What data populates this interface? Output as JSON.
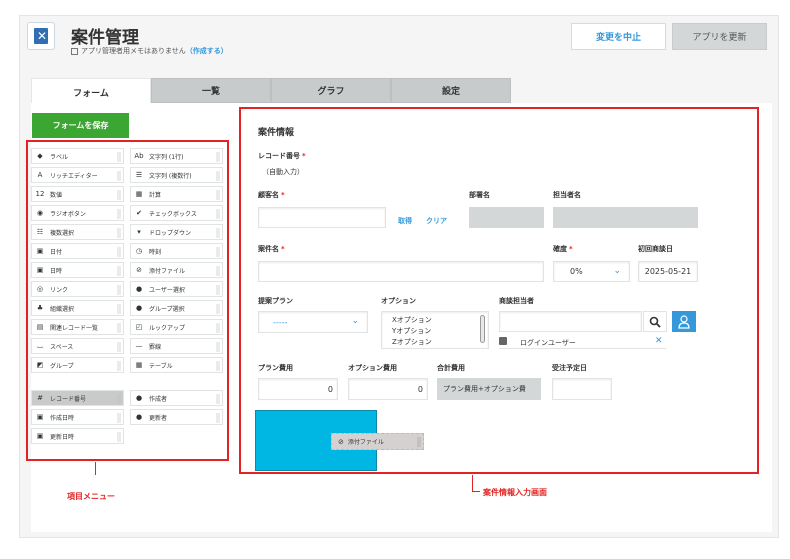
{
  "header": {
    "app_title": "案件管理",
    "memo_text": "アプリ管理者用メモはありません",
    "memo_link": "（作成する）",
    "cancel_label": "変更を中止",
    "update_label": "アプリを更新"
  },
  "tabs": [
    {
      "label": "フォーム"
    },
    {
      "label": "一覧"
    },
    {
      "label": "グラフ"
    },
    {
      "label": "設定"
    }
  ],
  "save_label": "フォームを保存",
  "menu_items": [
    {
      "label": "ラベル",
      "icon": "tag-icon"
    },
    {
      "label": "文字列 (1行)",
      "icon": "text-single-icon"
    },
    {
      "label": "リッチエディター",
      "icon": "rich-editor-icon"
    },
    {
      "label": "文字列 (複数行)",
      "icon": "text-multi-icon"
    },
    {
      "label": "数値",
      "icon": "number-icon"
    },
    {
      "label": "計算",
      "icon": "calc-icon"
    },
    {
      "label": "ラジオボタン",
      "icon": "radio-icon"
    },
    {
      "label": "チェックボックス",
      "icon": "checkbox-icon"
    },
    {
      "label": "複数選択",
      "icon": "multi-select-icon"
    },
    {
      "label": "ドロップダウン",
      "icon": "dropdown-icon"
    },
    {
      "label": "日付",
      "icon": "date-icon"
    },
    {
      "label": "時刻",
      "icon": "clock-icon"
    },
    {
      "label": "日時",
      "icon": "datetime-icon"
    },
    {
      "label": "添付ファイル",
      "icon": "attachment-icon"
    },
    {
      "label": "リンク",
      "icon": "link-icon"
    },
    {
      "label": "ユーザー選択",
      "icon": "user-icon"
    },
    {
      "label": "組織選択",
      "icon": "org-icon"
    },
    {
      "label": "グループ選択",
      "icon": "group-icon"
    },
    {
      "label": "関連レコード一覧",
      "icon": "related-records-icon"
    },
    {
      "label": "ルックアップ",
      "icon": "lookup-icon"
    },
    {
      "label": "スペース",
      "icon": "space-icon"
    },
    {
      "label": "罫線",
      "icon": "divider-icon"
    },
    {
      "label": "グループ",
      "icon": "group-field-icon"
    },
    {
      "label": "テーブル",
      "icon": "table-icon"
    },
    {
      "label": "レコード番号",
      "icon": "record-number-icon"
    },
    {
      "label": "作成者",
      "icon": "creator-icon"
    },
    {
      "label": "作成日時",
      "icon": "created-at-icon"
    },
    {
      "label": "更新者",
      "icon": "modifier-icon"
    },
    {
      "label": "更新日時",
      "icon": "updated-at-icon"
    }
  ],
  "form": {
    "section_title": "案件情報",
    "record_number_label": "レコード番号",
    "record_number_value": "（自動入力）",
    "customer_label": "顧客名",
    "fetch_label": "取得",
    "clear_label": "クリア",
    "department_label": "部署名",
    "contact_label": "担当者名",
    "deal_label": "案件名",
    "probability_label": "確度",
    "probability_value": "0%",
    "first_meeting_label": "初回商談日",
    "first_meeting_value": "2025-05-21",
    "plan_label": "提案プラン",
    "plan_value": "-----",
    "options_label": "オプション",
    "options": [
      "Xオプション",
      "Yオプション",
      "Zオプション"
    ],
    "sales_rep_label": "商談担当者",
    "login_user": "ログインユーザー",
    "plan_cost_label": "プラン費用",
    "plan_cost_value": "0",
    "option_cost_label": "オプション費用",
    "option_cost_value": "0",
    "total_cost_label": "合計費用",
    "total_cost_value": "プラン費用+オプション費",
    "order_date_label": "受注予定日",
    "drag_chip_label": "添付ファイル"
  },
  "annotations": {
    "menu": "項目メニュー",
    "form": "案件情報入力画面"
  }
}
